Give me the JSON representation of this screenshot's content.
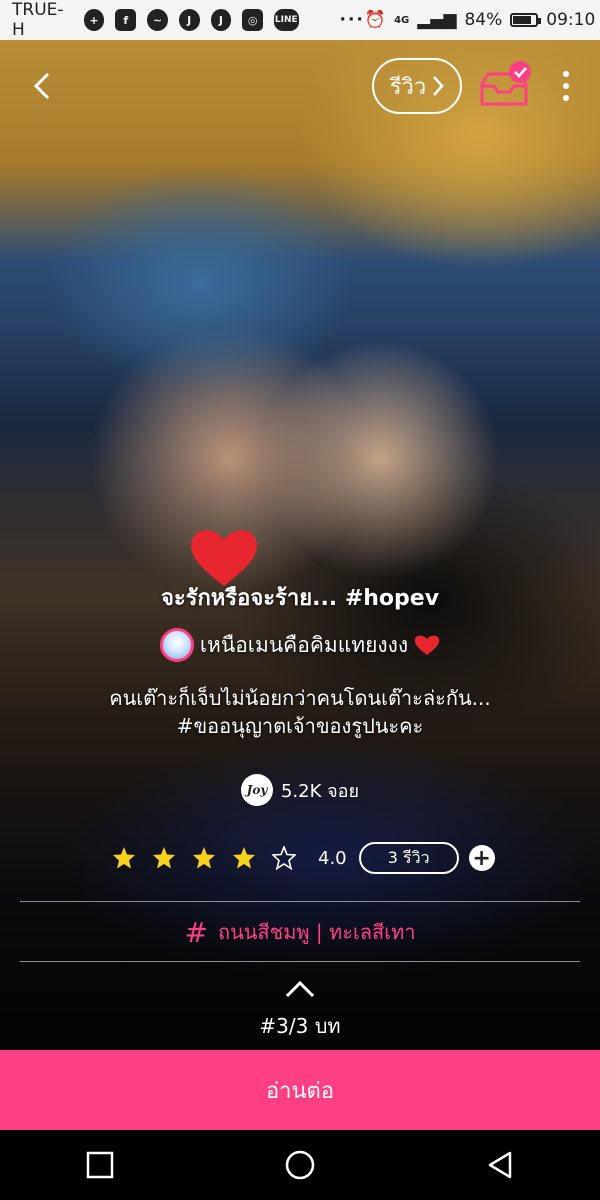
{
  "status_bar": {
    "carrier": "TRUE-H",
    "network": "4G",
    "battery": "84%",
    "battery_level": 0.84,
    "time": "09:10",
    "icons": [
      "add-contact-icon",
      "facebook-icon",
      "messenger-icon",
      "joylada-icon",
      "joylada-icon",
      "instagram-icon",
      "line-icon",
      "more-notifications-icon",
      "alarm-icon",
      "signal-icon",
      "battery-icon"
    ]
  },
  "header": {
    "review_label": "รีวิว"
  },
  "story": {
    "title": "จะรักหรือจะร้าย... #hopev",
    "author": "เหนือเมนคือคิมแทยงงง",
    "description_line1": "คนเต๊าะก็เจ็บไม่น้อยกว่าคนโดนเต๊าะล่ะกัน...",
    "description_line2": "#ขออนุญาตเจ้าของรูปนะคะ",
    "joys": "5.2K จอย",
    "rating": "4.0",
    "rating_stars_filled": 4,
    "rating_stars_total": 5,
    "review_count": "3 รีวิว",
    "tags": "ถนนสีชมพู | ทะเลสีเทา",
    "chapter": "#3/3 บท"
  },
  "actions": {
    "read_more": "อ่านต่อ"
  },
  "colors": {
    "accent": "#ff3f83",
    "star": "#f7d21d"
  }
}
